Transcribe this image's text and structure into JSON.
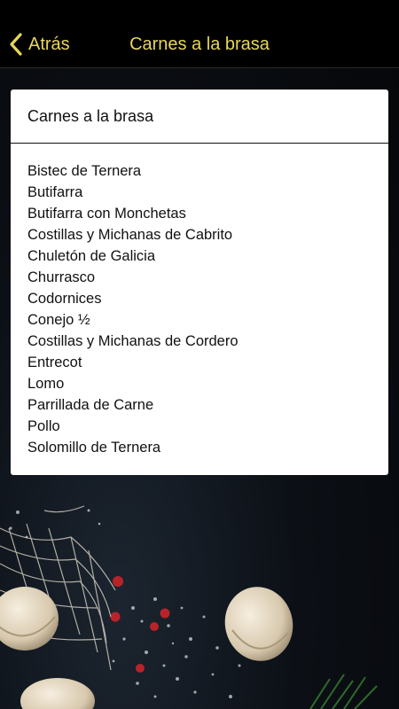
{
  "navbar": {
    "back_label": "Atrás",
    "title": "Carnes a la brasa",
    "accent_color": "#e8d65a",
    "back_icon": "chevron-left-icon"
  },
  "card": {
    "title": "Carnes a la brasa",
    "items": [
      "Bistec de Ternera",
      "Butifarra",
      "Butifarra con Monchetas",
      "Costillas y Michanas de Cabrito",
      "Chuletón de Galicia",
      "Churrasco",
      "Codornices",
      "Conejo ½",
      "Costillas y Michanas de Cordero",
      "Entrecot",
      "Lomo",
      "Parrillada de Carne",
      "Pollo",
      "Solomillo de Ternera"
    ]
  },
  "background": {
    "description_icon": "food-photo-background"
  }
}
